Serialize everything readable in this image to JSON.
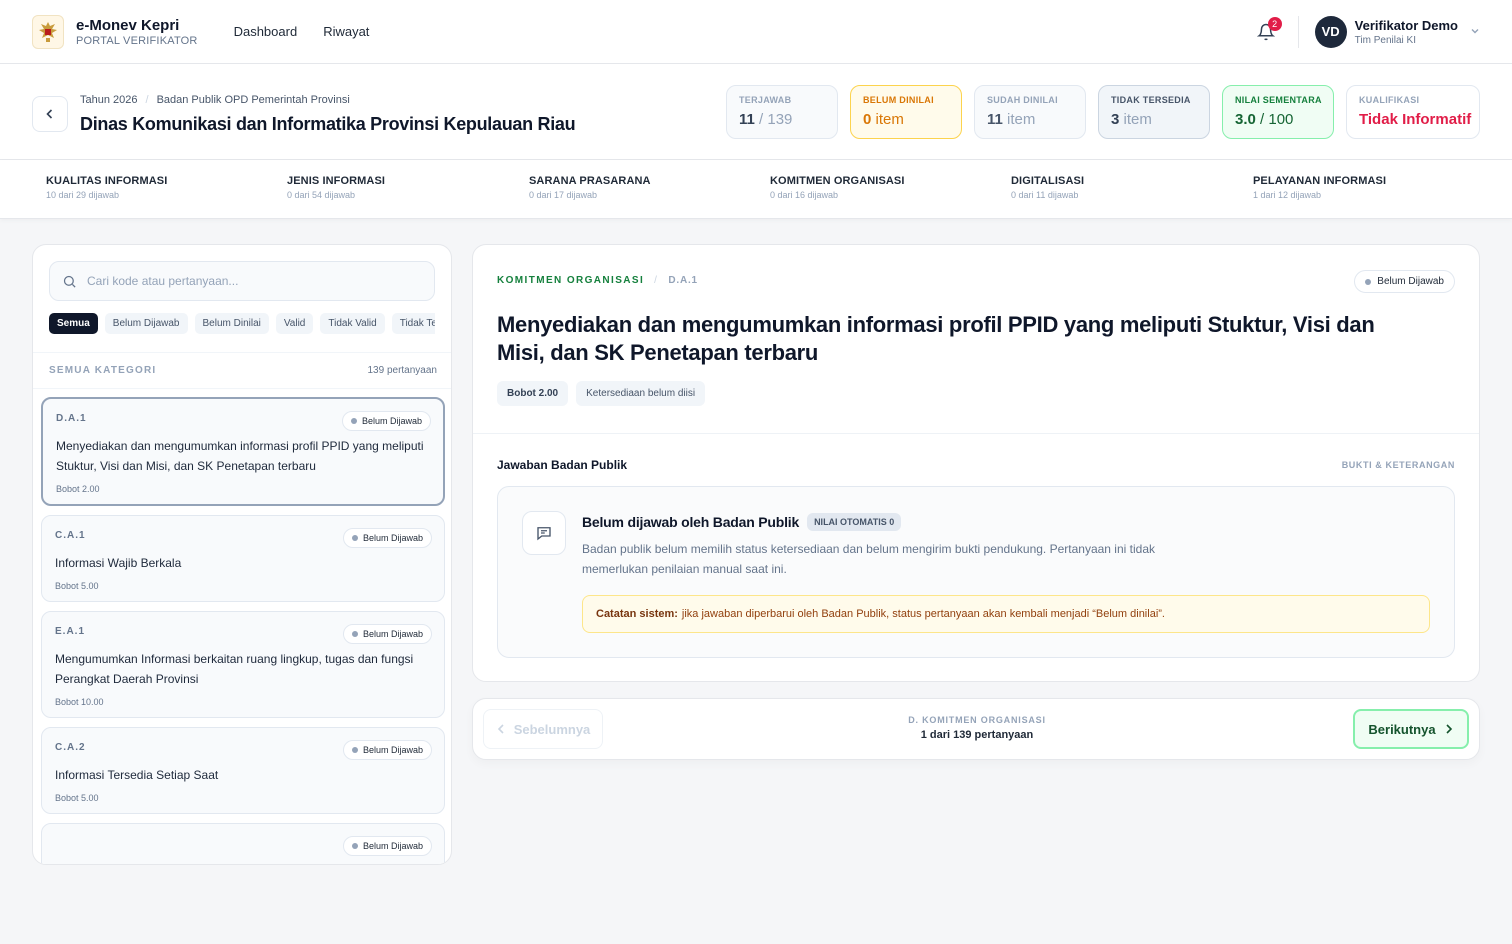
{
  "app": {
    "title": "e-Monev Kepri",
    "subtitle": "PORTAL VERIFIKATOR"
  },
  "nav": {
    "items": [
      "Dashboard",
      "Riwayat"
    ]
  },
  "notifications": {
    "count": "2"
  },
  "user": {
    "initials": "VD",
    "name": "Verifikator Demo",
    "role": "Tim Penilai KI"
  },
  "breadcrumb": {
    "year": "Tahun 2026",
    "group": "Badan Publik OPD Pemerintah Provinsi"
  },
  "page": {
    "title": "Dinas Komunikasi dan Informatika Provinsi Kepulauan Riau"
  },
  "stats": {
    "terjawab": {
      "label": "TERJAWAB",
      "value": "11",
      "suffix": " / 139"
    },
    "belum_dinilai": {
      "label": "BELUM DINILAI",
      "value": "0",
      "suffix": " item"
    },
    "sudah_dinilai": {
      "label": "SUDAH DINILAI",
      "value": "11",
      "suffix": " item"
    },
    "tidak_tersedia": {
      "label": "TIDAK TERSEDIA",
      "value": "3",
      "suffix": " item"
    },
    "nilai_sementara": {
      "label": "NILAI SEMENTARA",
      "value": "3.0",
      "suffix": " / 100"
    },
    "kualifikasi": {
      "label": "KUALIFIKASI",
      "value": "Tidak Informatif"
    }
  },
  "categories": [
    {
      "name": "KUALITAS INFORMASI",
      "sub": "10 dari 29 dijawab"
    },
    {
      "name": "JENIS INFORMASI",
      "sub": "0 dari 54 dijawab"
    },
    {
      "name": "SARANA PRASARANA",
      "sub": "0 dari 17 dijawab"
    },
    {
      "name": "KOMITMEN ORGANISASI",
      "sub": "0 dari 16 dijawab"
    },
    {
      "name": "DIGITALISASI",
      "sub": "0 dari 11 dijawab"
    },
    {
      "name": "PELAYANAN INFORMASI",
      "sub": "1 dari 12 dijawab"
    }
  ],
  "search": {
    "placeholder": "Cari kode atau pertanyaan..."
  },
  "filters": [
    "Semua",
    "Belum Dijawab",
    "Belum Dinilai",
    "Valid",
    "Tidak Valid",
    "Tidak Tersedia"
  ],
  "list": {
    "title": "SEMUA KATEGORI",
    "count": "139 pertanyaan",
    "items": [
      {
        "code": "D.A.1",
        "status": "Belum Dijawab",
        "question": "Menyediakan dan mengumumkan informasi profil PPID yang meliputi Stuktur, Visi dan Misi, dan SK Penetapan terbaru",
        "weight": "Bobot 2.00"
      },
      {
        "code": "C.A.1",
        "status": "Belum Dijawab",
        "question": "Informasi Wajib Berkala",
        "weight": "Bobot 5.00"
      },
      {
        "code": "E.A.1",
        "status": "Belum Dijawab",
        "question": "Mengumumkan Informasi berkaitan ruang lingkup, tugas dan fungsi Perangkat Daerah Provinsi",
        "weight": "Bobot 10.00"
      },
      {
        "code": "C.A.2",
        "status": "Belum Dijawab",
        "question": "Informasi Tersedia Setiap Saat",
        "weight": "Bobot 5.00"
      },
      {
        "code": "",
        "status": "Belum Dijawab",
        "question": "",
        "weight": ""
      }
    ]
  },
  "detail": {
    "category": "KOMITMEN ORGANISASI",
    "code": "D.A.1",
    "status": "Belum Dijawab",
    "title": "Menyediakan dan mengumumkan informasi profil PPID yang meliputi Stuktur, Visi dan Misi, dan SK Penetapan terbaru",
    "tags": [
      "Bobot 2.00",
      "Ketersediaan belum diisi"
    ],
    "section_title": "Jawaban Badan Publik",
    "section_right": "BUKTI & KETERANGAN",
    "answer": {
      "title": "Belum dijawab oleh Badan Publik",
      "badge": "NILAI OTOMATIS 0",
      "desc": "Badan publik belum memilih status ketersediaan dan belum mengirim bukti pendukung. Pertanyaan ini tidak memerlukan penilaian manual saat ini.",
      "note_label": "Catatan sistem:",
      "note_text": "jika jawaban diperbarui oleh Badan Publik, status pertanyaan akan kembali menjadi “Belum dinilai”."
    }
  },
  "pager": {
    "prev": "Sebelumnya",
    "next": "Berikutnya",
    "section": "D. KOMITMEN ORGANISASI",
    "position": "1 dari 139 pertanyaan"
  },
  "colors": {
    "accent_green": "#15803d",
    "warning": "#d97706",
    "danger": "#e11d48",
    "dark": "#0f172a"
  }
}
